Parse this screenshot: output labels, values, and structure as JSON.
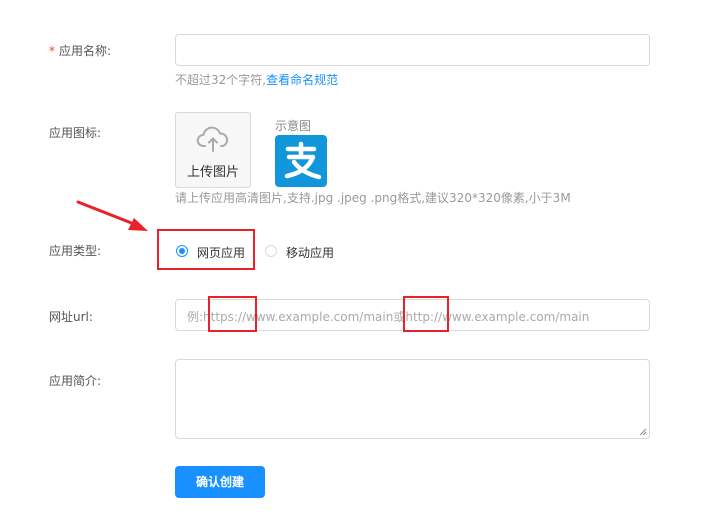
{
  "form": {
    "app_name": {
      "required_mark": "*",
      "label": "应用名称:",
      "value": "",
      "hint_prefix": "不超过32个字符,",
      "hint_link": "查看命名规范"
    },
    "app_icon": {
      "label": "应用图标:",
      "upload_label": "上传图片",
      "sample_label": "示意图",
      "hint": "请上传应用高清图片,支持.jpg .jpeg .png格式,建议320*320像素,小于3M"
    },
    "app_type": {
      "label": "应用类型:",
      "options": [
        {
          "label": "网页应用",
          "checked": true
        },
        {
          "label": "移动应用",
          "checked": false
        }
      ]
    },
    "url": {
      "label": "网址url:",
      "placeholder": "例:https://www.example.com/main或http://www.example.com/main"
    },
    "description": {
      "label": "应用简介:",
      "value": ""
    },
    "submit_label": "确认创建"
  },
  "colors": {
    "accent": "#1890ff",
    "required": "#f04134",
    "annotation": "#e8212a",
    "alipay_blue": "#1296db"
  },
  "icons": [
    "upload-cloud-icon",
    "alipay-logo-icon",
    "annotation-arrow-icon"
  ]
}
